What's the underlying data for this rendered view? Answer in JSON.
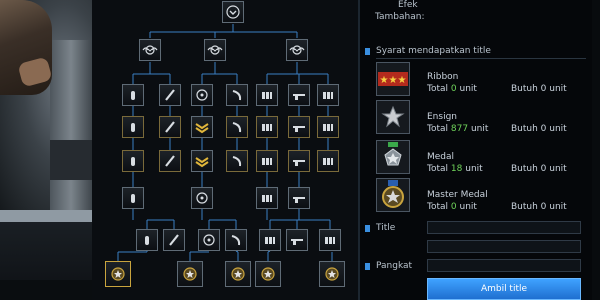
{
  "character": {
    "description_icon": "soldier-figure"
  },
  "tree": {
    "connector_color": "#3a7fc4",
    "rows": [
      {
        "id": "root",
        "icons": [
          "chevron-down-icon"
        ]
      },
      {
        "id": "tier1",
        "icons": [
          "wings-badge-icon",
          "wings-badge-icon",
          "wings-badge-icon"
        ]
      },
      {
        "id": "tier2",
        "icons": [
          "bullet-icon",
          "knife-icon",
          "crosshair-icon",
          "banana-icon",
          "ammo-icon",
          "rifle-icon",
          "ammo-icon"
        ]
      },
      {
        "id": "tier3",
        "icons": [
          "bullet-icon",
          "knife-icon",
          "chevron-rank-icon",
          "banana-icon",
          "ammo-icon",
          "rifle-icon",
          "ammo-icon"
        ]
      },
      {
        "id": "tier4",
        "icons": [
          "bullet-icon",
          "knife-icon",
          "chevron-rank-icon",
          "banana-icon",
          "ammo-icon",
          "rifle-icon",
          "ammo-icon"
        ]
      },
      {
        "id": "tier5",
        "icons": [
          "bullet-icon",
          "crosshair-icon",
          "ammo-icon",
          "rifle-icon"
        ]
      },
      {
        "id": "tier6",
        "icons": [
          "bullet-icon",
          "knife-icon",
          "crosshair-icon",
          "banana-icon",
          "ammo-icon",
          "rifle-icon",
          "ammo-icon"
        ]
      },
      {
        "id": "tier7",
        "icons": [
          "master-badge-icon",
          "master-badge-icon",
          "master-badge-icon",
          "master-badge-icon",
          "master-badge-icon"
        ]
      }
    ]
  },
  "right": {
    "efek_label": "Efek",
    "tambahan_label": "Tambahan:",
    "syarat_label": "Syarat mendapatkan title",
    "accent": "#3a8fe0",
    "green": "#6fd25a",
    "requirements": [
      {
        "name": "Ribbon",
        "total_prefix": "Total",
        "total_value": "0",
        "total_suffix": "unit",
        "need": "Butuh 0 unit",
        "icon": "ribbon-icon"
      },
      {
        "name": "Ensign",
        "total_prefix": "Total",
        "total_value": "877",
        "total_suffix": "unit",
        "need": "Butuh 0 unit",
        "icon": "ensign-icon"
      },
      {
        "name": "Medal",
        "total_prefix": "Total",
        "total_value": "18",
        "total_suffix": "unit",
        "need": "Butuh 0 unit",
        "icon": "medal-icon"
      },
      {
        "name": "Master Medal",
        "total_prefix": "Total",
        "total_value": "0",
        "total_suffix": "unit",
        "need": "Butuh 0 unit",
        "icon": "master-medal-icon"
      }
    ],
    "title_label": "Title",
    "pangkat_label": "Pangkat",
    "button_label": "Ambil title"
  }
}
